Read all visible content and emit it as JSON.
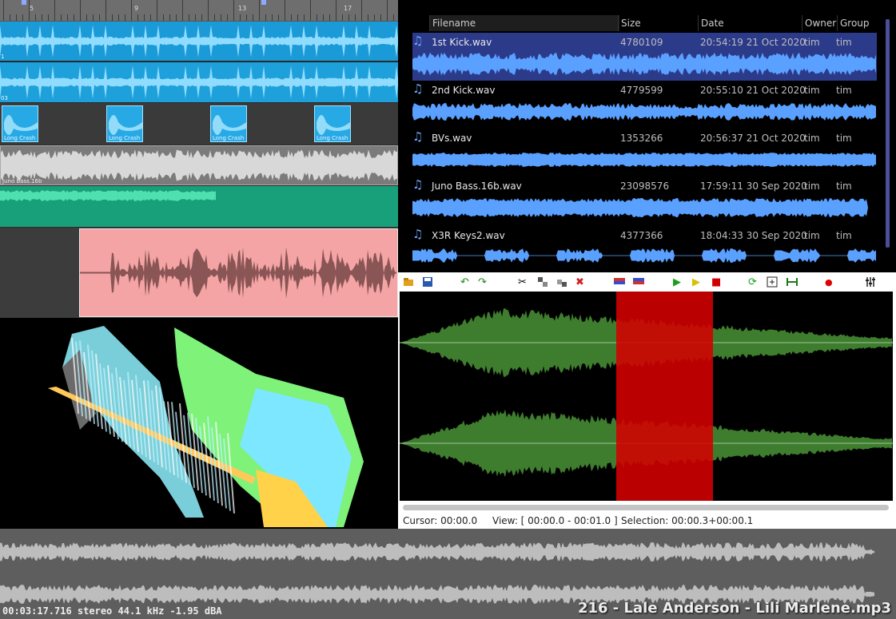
{
  "timeline": {
    "ruler_numbers": [
      "5",
      "9",
      "13",
      "17"
    ],
    "clip_labels": {
      "track1": "1",
      "track2": "03",
      "crash": "Long Crash",
      "juno": "Juno Bass.16b"
    },
    "colors": {
      "blue_clip": "#1fa3dc",
      "crash": "#27a9e6",
      "grey_clip": "#7a7a7a",
      "green_clip": "#16a07a",
      "pink_clip": "#f3a3a3"
    }
  },
  "browser": {
    "columns": {
      "filename": "Filename",
      "size": "Size",
      "date": "Date",
      "owner": "Owner",
      "group": "Group"
    },
    "files": [
      {
        "name": "1st Kick.wav",
        "size": "4780109",
        "date": "20:54:19 21 Oct 2020",
        "owner": "tim",
        "group": "tim",
        "selected": true
      },
      {
        "name": "2nd Kick.wav",
        "size": "4779599",
        "date": "20:55:10 21 Oct 2020",
        "owner": "tim",
        "group": "tim"
      },
      {
        "name": "BVs.wav",
        "size": "1353266",
        "date": "20:56:37 21 Oct 2020",
        "owner": "tim",
        "group": "tim"
      },
      {
        "name": "Juno Bass.16b.wav",
        "size": "23098576",
        "date": "17:59:11 30 Sep 2020",
        "owner": "tim",
        "group": "tim"
      },
      {
        "name": "X3R Keys2.wav",
        "size": "4377366",
        "date": "18:04:33 30 Sep 2020",
        "owner": "tim",
        "group": "tim"
      }
    ],
    "icon": "music-note-icon",
    "waveform_color": "#5aa0ff"
  },
  "editor": {
    "toolbar_icons": [
      "open-icon",
      "save-icon",
      "undo-icon",
      "redo-icon",
      "cut-icon",
      "copy-icon",
      "paste-icon",
      "delete-icon",
      "mix-icon",
      "mix-icon",
      "play-icon",
      "pause-icon",
      "stop-icon",
      "loop-icon",
      "zoom-fit-icon",
      "zoom-selection-icon",
      "record-icon",
      "settings-icon"
    ],
    "status": {
      "cursor": "Cursor: 00:00.0",
      "view": "View: [ 00:00.0 - 00:01.0 ]",
      "selection": "Selection: 00:00.3+00:00.1"
    },
    "colors": {
      "waveform": "#3e7c2e",
      "selection": "#d40000"
    }
  },
  "overview": {
    "info": "00:03:17.716  stereo  44.1 kHz  -1.95 dBA",
    "title": "216 - Lale Anderson - Lili Marlene.mp3"
  }
}
